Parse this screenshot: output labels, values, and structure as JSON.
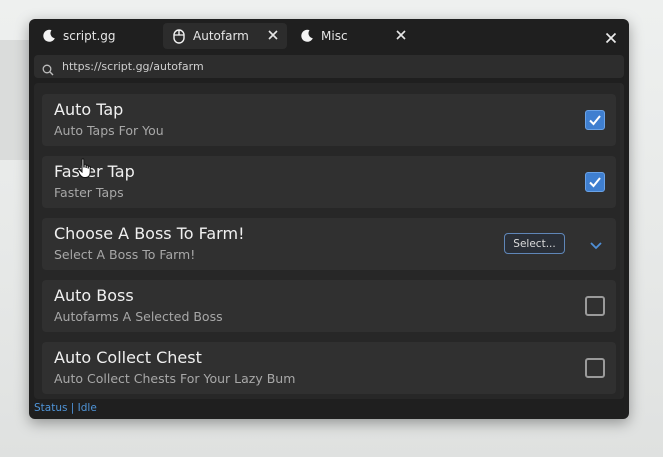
{
  "tabs": [
    {
      "label": "script.gg",
      "icon": "moon-icon",
      "active": false,
      "closable": false
    },
    {
      "label": "Autofarm",
      "icon": "mouse-icon",
      "active": true,
      "closable": true
    },
    {
      "label": "Misc",
      "icon": "moon-icon",
      "active": false,
      "closable": true
    }
  ],
  "url": {
    "value": "https://script.gg/autofarm"
  },
  "items": [
    {
      "title": "Auto Tap",
      "desc": "Auto Taps For You",
      "control": "checkbox",
      "checked": true
    },
    {
      "title": "Faster Tap",
      "desc": "Faster Taps",
      "control": "checkbox",
      "checked": true
    },
    {
      "title": "Choose A Boss To Farm!",
      "desc": "Select A Boss To Farm!",
      "control": "dropdown",
      "select_label": "Select..."
    },
    {
      "title": "Auto Boss",
      "desc": "Autofarms A Selected Boss",
      "control": "checkbox",
      "checked": false
    },
    {
      "title": "Auto Collect Chest",
      "desc": "Auto Collect Chests For Your Lazy Bum",
      "control": "checkbox",
      "checked": false
    }
  ],
  "status": {
    "text": "Status | Idle"
  },
  "colors": {
    "accent": "#3f7fd0",
    "status": "#4f94d8",
    "window_bg": "#1f1f1f"
  }
}
